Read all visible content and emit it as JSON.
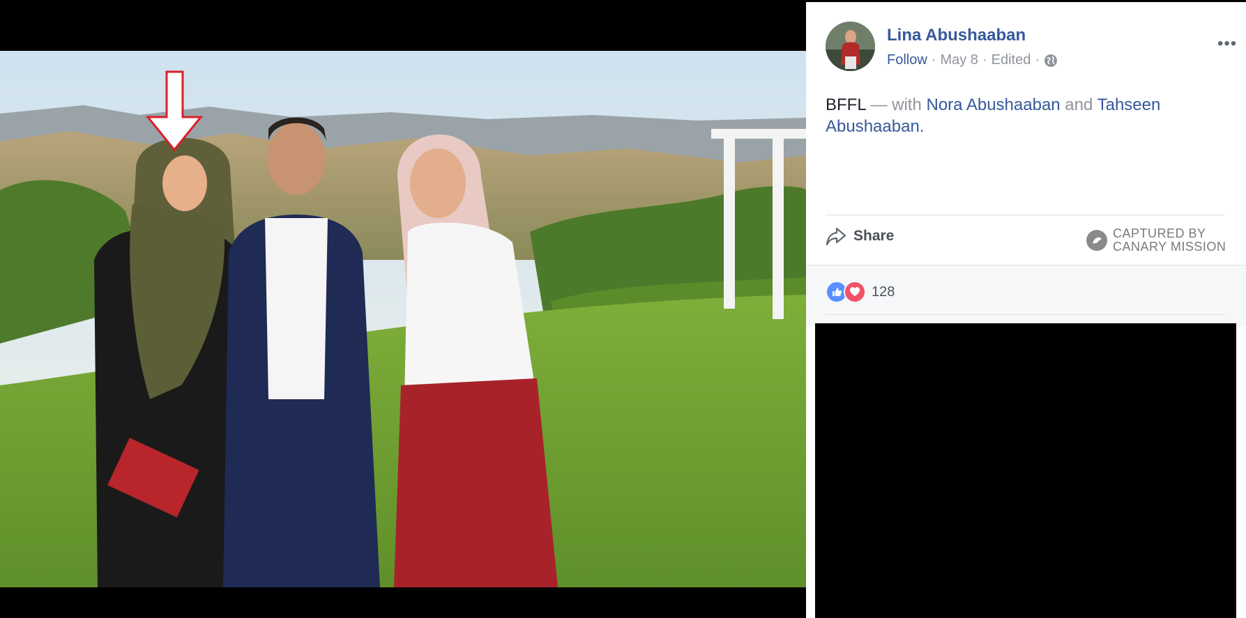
{
  "post": {
    "author": "Lina Abushaaban",
    "follow": "Follow",
    "date": "May 8",
    "edited": "Edited",
    "more_icon": "more-icon",
    "text_main": "BFFL",
    "text_with": " — with ",
    "tag1": "Nora Abushaaban",
    "text_and": " and ",
    "tag2": "Tahseen Abushaaban",
    "text_end": "."
  },
  "actions": {
    "share_label": "Share",
    "share_icon": "share-arrow-icon"
  },
  "watermark": {
    "line1": "CAPTURED BY",
    "line2": "CANARY MISSION"
  },
  "reactions": {
    "icons": [
      "like-icon",
      "love-icon"
    ],
    "count": "128"
  },
  "colors": {
    "link": "#365899",
    "annotation_arrow": "#d9202a"
  }
}
